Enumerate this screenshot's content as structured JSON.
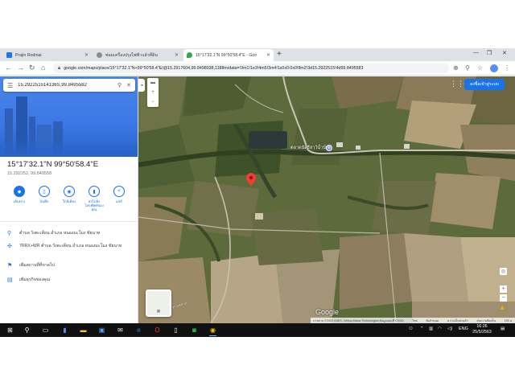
{
  "browser": {
    "tabs": [
      {
        "title": "Prajin Rodmai",
        "favicon_color": "#1877f2",
        "active": false
      },
      {
        "title": "ซ่อมเครื่องปรุงไฟฟ้าแล้วที่ดิน",
        "favicon_color": "#8c8c8c",
        "active": false
      },
      {
        "title": "15°17'32.1\"N 99°50'58.4\"E - Goo",
        "favicon_color": "#34a853",
        "active": true
      }
    ],
    "new_tab": "+",
    "url": "google.com/maps/place/15°17'32.1\"N+99°50'58.4\"E/@15.2917604,99.8498038,1188m/data=!3m1!1e3!4m5!3m4!1s0x0:0x0!8m2!3d15.2922515!4d99.8495583"
  },
  "panel": {
    "search_query": "15.292251514136S,99.8495582",
    "coord_title": "15°17'32.1\"N 99°50'58.4\"E",
    "coord_sub": "15.292252, 99.849558",
    "actions": [
      {
        "label": "เส้นทาง",
        "icon": "directions-icon"
      },
      {
        "label": "บันทึก",
        "icon": "bookmark-icon"
      },
      {
        "label": "ใกล้เคียง",
        "icon": "nearby-icon"
      },
      {
        "label": "ส่งไปยังโทรศัพท์ของคุณ",
        "icon": "phone-icon"
      },
      {
        "label": "แชร์",
        "icon": "share-icon"
      }
    ],
    "info": [
      {
        "text": "ตำบล วังตะเคียน อำเภอ หนองมะโมง ชัยนาท",
        "icon": "place-icon"
      },
      {
        "text": "7RRX+WR ตำบล วังตะเคียน อำเภอ หนองมะโมง ชัยนาท",
        "icon": "plus-code-icon"
      },
      {
        "text": "เพิ่มสถานที่ที่ขาดไป",
        "icon": "add-place-icon"
      },
      {
        "text": "เพิ่มธุรกิจของคุณ",
        "icon": "business-icon"
      }
    ]
  },
  "map": {
    "signin_label": "ลงชื่อเข้าสู่ระบบ",
    "place_label": "ตลาดนัดรีสาว์น้ำนั่น",
    "road_label": "ทางหลวง",
    "google_logo": "Google",
    "attribution": "ภาพถ่าย ©2020 CNES / Airbus,Maxar Technologies,ข้อมูลแผนที่ ©2020",
    "attribution_links": [
      "ไทย",
      "ข้อกำหนด",
      "ความเป็นส่วนตัว",
      "ส่งความคิดเห็น"
    ],
    "scale": "100 ม.",
    "pin_color": "#ea4335"
  },
  "taskbar": {
    "tray_lang": "ENG",
    "time": "16:26",
    "date": "25/5/2563"
  }
}
